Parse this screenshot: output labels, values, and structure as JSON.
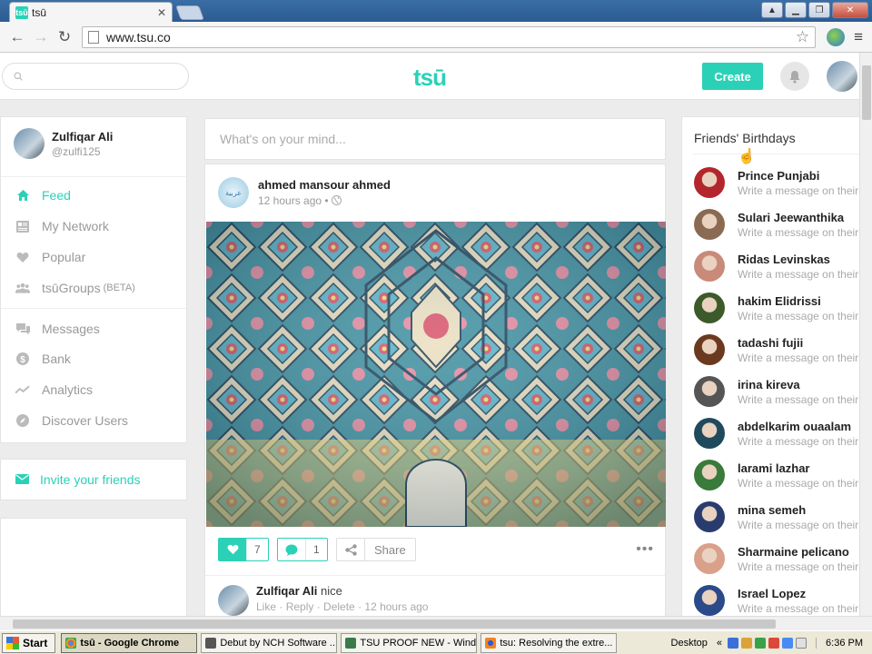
{
  "browser": {
    "tab_title": "tsū",
    "favicon_text": "tsū",
    "url": "www.tsu.co",
    "icons": [
      "back-icon",
      "forward-icon",
      "reload-icon",
      "star-icon",
      "menu-icon"
    ]
  },
  "site": {
    "search_placeholder": "",
    "logo": "tsū",
    "create_label": "Create"
  },
  "profile": {
    "name": "Zulfiqar Ali",
    "handle": "@zulfi125"
  },
  "nav": {
    "feed": "Feed",
    "my_network": "My Network",
    "popular": "Popular",
    "groups": "tsūGroups",
    "groups_beta": "(BETA)",
    "messages": "Messages",
    "bank": "Bank",
    "analytics": "Analytics",
    "discover": "Discover Users"
  },
  "invite": "Invite your friends",
  "compose_placeholder": "What's on your mind...",
  "post": {
    "author": "ahmed mansour ahmed",
    "time": "12 hours ago •",
    "avatar_text": "عربية",
    "likes": "7",
    "comments": "1",
    "share_label": "Share",
    "comment": {
      "author": "Zulfiqar Ali",
      "text": "nice",
      "like": "Like",
      "reply": "Reply",
      "delete": "Delete",
      "time": "12 hours ago"
    }
  },
  "birthdays": {
    "title": "Friends' Birthdays",
    "sub": "Write a message on their",
    "items": [
      {
        "name": "Prince Punjabi",
        "color": "#b3262b"
      },
      {
        "name": "Sulari Jeewanthika",
        "color": "#8a6a52"
      },
      {
        "name": "Ridas Levinskas",
        "color": "#c98a7a"
      },
      {
        "name": "hakim Elidrissi",
        "color": "#3c5a2a"
      },
      {
        "name": "tadashi fujii",
        "color": "#6b3a1e"
      },
      {
        "name": "irina kireva",
        "color": "#555555"
      },
      {
        "name": "abdelkarim ouaalam",
        "color": "#1f4a5e"
      },
      {
        "name": "larami lazhar",
        "color": "#3a7a3a"
      },
      {
        "name": "mina semeh",
        "color": "#2a3c6e"
      },
      {
        "name": "Sharmaine pelicano",
        "color": "#d9a08a"
      },
      {
        "name": "Israel Lopez",
        "color": "#2a4a8a"
      }
    ]
  },
  "taskbar": {
    "start": "Start",
    "tasks": [
      "tsū - Google Chrome",
      "Debut by NCH Software ...",
      "TSU PROOF NEW - Wind...",
      "tsu: Resolving the extre..."
    ],
    "desktop": "Desktop",
    "clock": "6:36 PM"
  },
  "colors": {
    "brand": "#2bd1b6"
  }
}
